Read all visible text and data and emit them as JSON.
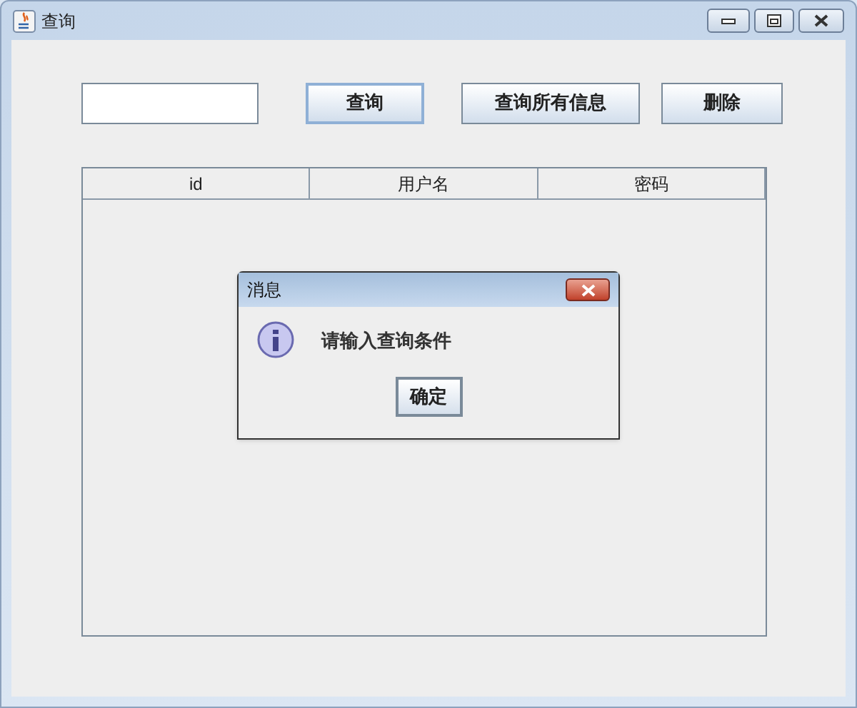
{
  "window": {
    "title": "查询"
  },
  "buttons": [
    "查询",
    "查询所有信息",
    "删除"
  ],
  "table": {
    "columns": [
      "id",
      "用户名",
      "密码"
    ]
  },
  "dialog": {
    "title": "消息",
    "message": "请输入查询条件",
    "button": "确定"
  }
}
